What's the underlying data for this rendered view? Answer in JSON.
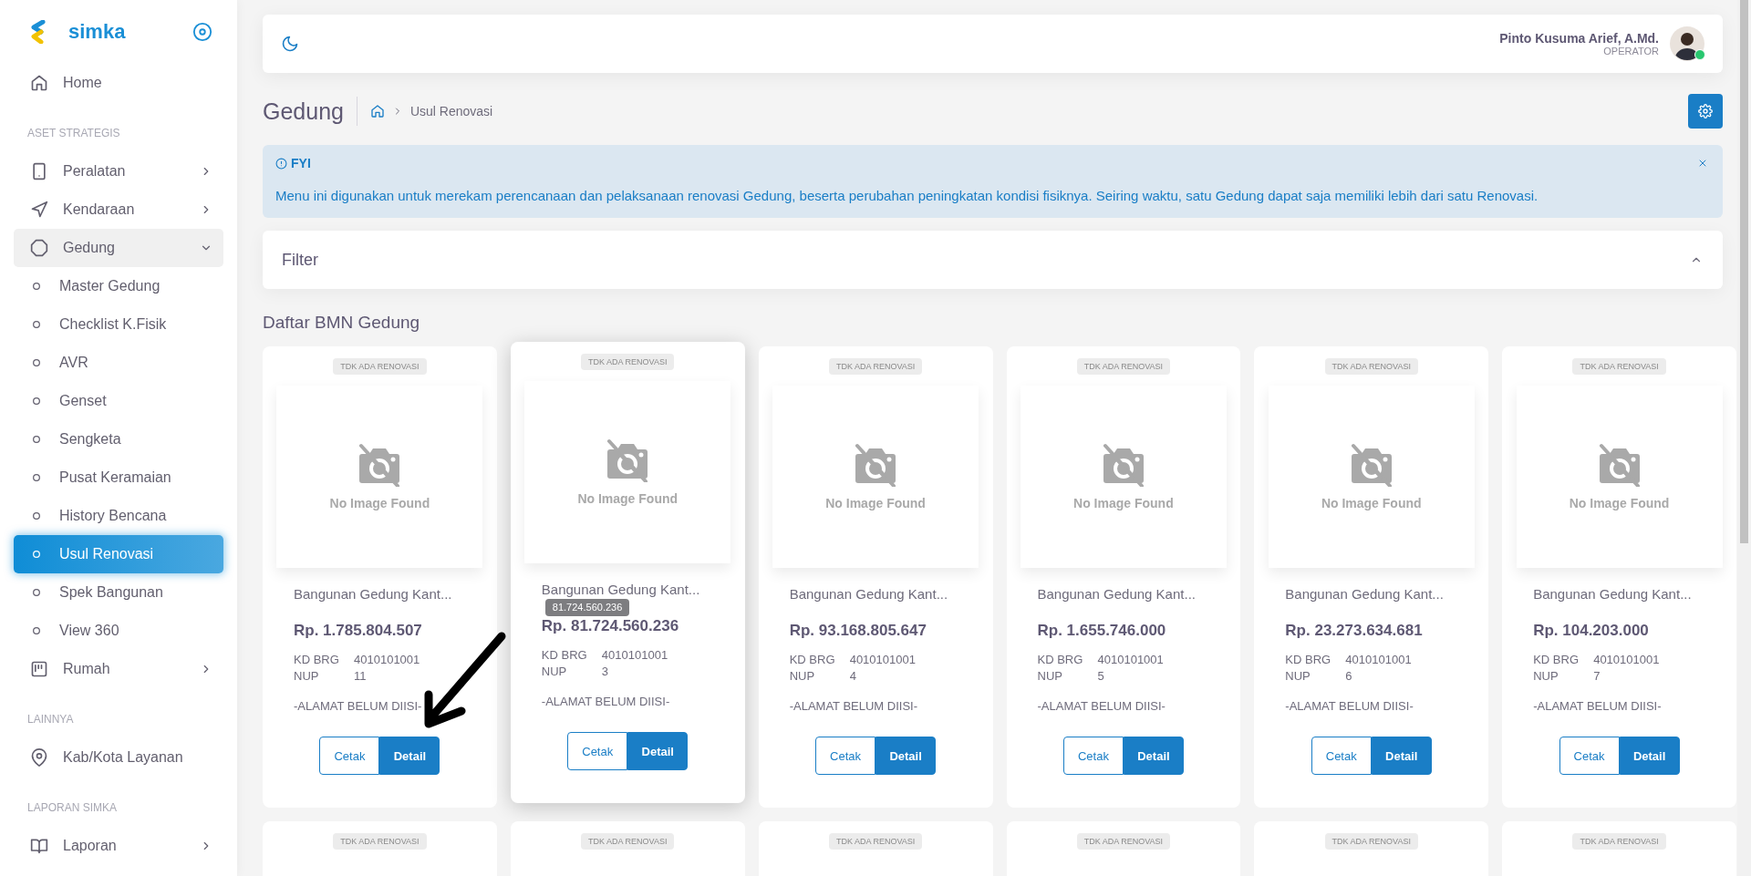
{
  "sidebar": {
    "brand": "simka",
    "sections": [
      {
        "items": [
          {
            "label": "Home",
            "selected": false
          }
        ]
      },
      {
        "heading": "ASET STRATEGIS",
        "items": [
          {
            "label": "Peralatan",
            "selected": false,
            "expanded": false
          },
          {
            "label": "Kendaraan",
            "selected": false,
            "expanded": false
          },
          {
            "label": "Gedung",
            "selected": false,
            "expanded": true,
            "children": [
              {
                "label": "Master Gedung",
                "selected": false
              },
              {
                "label": "Checklist K.Fisik",
                "selected": false
              },
              {
                "label": "AVR",
                "selected": false
              },
              {
                "label": "Genset",
                "selected": false
              },
              {
                "label": "Sengketa",
                "selected": false
              },
              {
                "label": "Pusat Keramaian",
                "selected": false
              },
              {
                "label": "History Bencana",
                "selected": false
              },
              {
                "label": "Usul Renovasi",
                "selected": true
              },
              {
                "label": "Spek Bangunan",
                "selected": false
              },
              {
                "label": "View 360",
                "selected": false
              }
            ]
          },
          {
            "label": "Rumah",
            "selected": false,
            "expanded": false
          }
        ]
      },
      {
        "heading": "LAINNYA",
        "items": [
          {
            "label": "Kab/Kota Layanan",
            "selected": false
          }
        ]
      },
      {
        "heading": "LAPORAN SIMKA",
        "items": [
          {
            "label": "Laporan",
            "selected": false,
            "expanded": false
          }
        ]
      }
    ]
  },
  "header": {
    "user_name": "Pinto Kusuma Arief, A.Md.",
    "user_role": "OPERATOR",
    "online": true
  },
  "page": {
    "title": "Gedung",
    "breadcrumb": [
      "Usul Renovasi"
    ]
  },
  "alert": {
    "title": "FYI",
    "message": "Menu ini digunakan untuk merekam perencanaan dan pelaksanaan renovasi Gedung, beserta perubahan peningkatan kondisi fisiknya. Seiring waktu, satu Gedung dapat saja memiliki lebih dari satu Renovasi."
  },
  "filter": {
    "title": "Filter",
    "expanded": true
  },
  "list_title": "Daftar BMN Gedung",
  "cards": [
    {
      "status": "TDK ADA RENOVASI",
      "image_text": "No Image Found",
      "title": "Bangunan Gedung Kant...",
      "price": "Rp. 1.785.804.507",
      "kd_brg_label": "KD BRG",
      "kd_brg": "4010101001",
      "nup_label": "NUP",
      "nup": "11",
      "address": "-ALAMAT BELUM DIISI-",
      "buttons": [
        "Cetak",
        "Detail"
      ],
      "hovered": false
    },
    {
      "status": "TDK ADA RENOVASI",
      "image_text": "No Image Found",
      "title": "Bangunan Gedung Kant...",
      "price": "Rp. 81.724.560.236",
      "tooltip": "81.724.560.236",
      "kd_brg_label": "KD BRG",
      "kd_brg": "4010101001",
      "nup_label": "NUP",
      "nup": "3",
      "address": "-ALAMAT BELUM DIISI-",
      "buttons": [
        "Cetak",
        "Detail"
      ],
      "hovered": true
    },
    {
      "status": "TDK ADA RENOVASI",
      "image_text": "No Image Found",
      "title": "Bangunan Gedung Kant...",
      "price": "Rp. 93.168.805.647",
      "kd_brg_label": "KD BRG",
      "kd_brg": "4010101001",
      "nup_label": "NUP",
      "nup": "4",
      "address": "-ALAMAT BELUM DIISI-",
      "buttons": [
        "Cetak",
        "Detail"
      ],
      "hovered": false
    },
    {
      "status": "TDK ADA RENOVASI",
      "image_text": "No Image Found",
      "title": "Bangunan Gedung Kant...",
      "price": "Rp. 1.655.746.000",
      "kd_brg_label": "KD BRG",
      "kd_brg": "4010101001",
      "nup_label": "NUP",
      "nup": "5",
      "address": "-ALAMAT BELUM DIISI-",
      "buttons": [
        "Cetak",
        "Detail"
      ],
      "hovered": false
    },
    {
      "status": "TDK ADA RENOVASI",
      "image_text": "No Image Found",
      "title": "Bangunan Gedung Kant...",
      "price": "Rp. 23.273.634.681",
      "kd_brg_label": "KD BRG",
      "kd_brg": "4010101001",
      "nup_label": "NUP",
      "nup": "6",
      "address": "-ALAMAT BELUM DIISI-",
      "buttons": [
        "Cetak",
        "Detail"
      ],
      "hovered": false
    },
    {
      "status": "TDK ADA RENOVASI",
      "image_text": "No Image Found",
      "title": "Bangunan Gedung Kant...",
      "price": "Rp. 104.203.000",
      "kd_brg_label": "KD BRG",
      "kd_brg": "4010101001",
      "nup_label": "NUP",
      "nup": "7",
      "address": "-ALAMAT BELUM DIISI-",
      "buttons": [
        "Cetak",
        "Detail"
      ],
      "hovered": false
    },
    {
      "status": "TDK ADA RENOVASI",
      "hovered": false
    },
    {
      "status": "TDK ADA RENOVASI",
      "hovered": false
    },
    {
      "status": "TDK ADA RENOVASI",
      "hovered": false
    },
    {
      "status": "TDK ADA RENOVASI",
      "hovered": false
    },
    {
      "status": "TDK ADA RENOVASI",
      "hovered": false
    },
    {
      "status": "TDK ADA RENOVASI",
      "hovered": false
    }
  ]
}
